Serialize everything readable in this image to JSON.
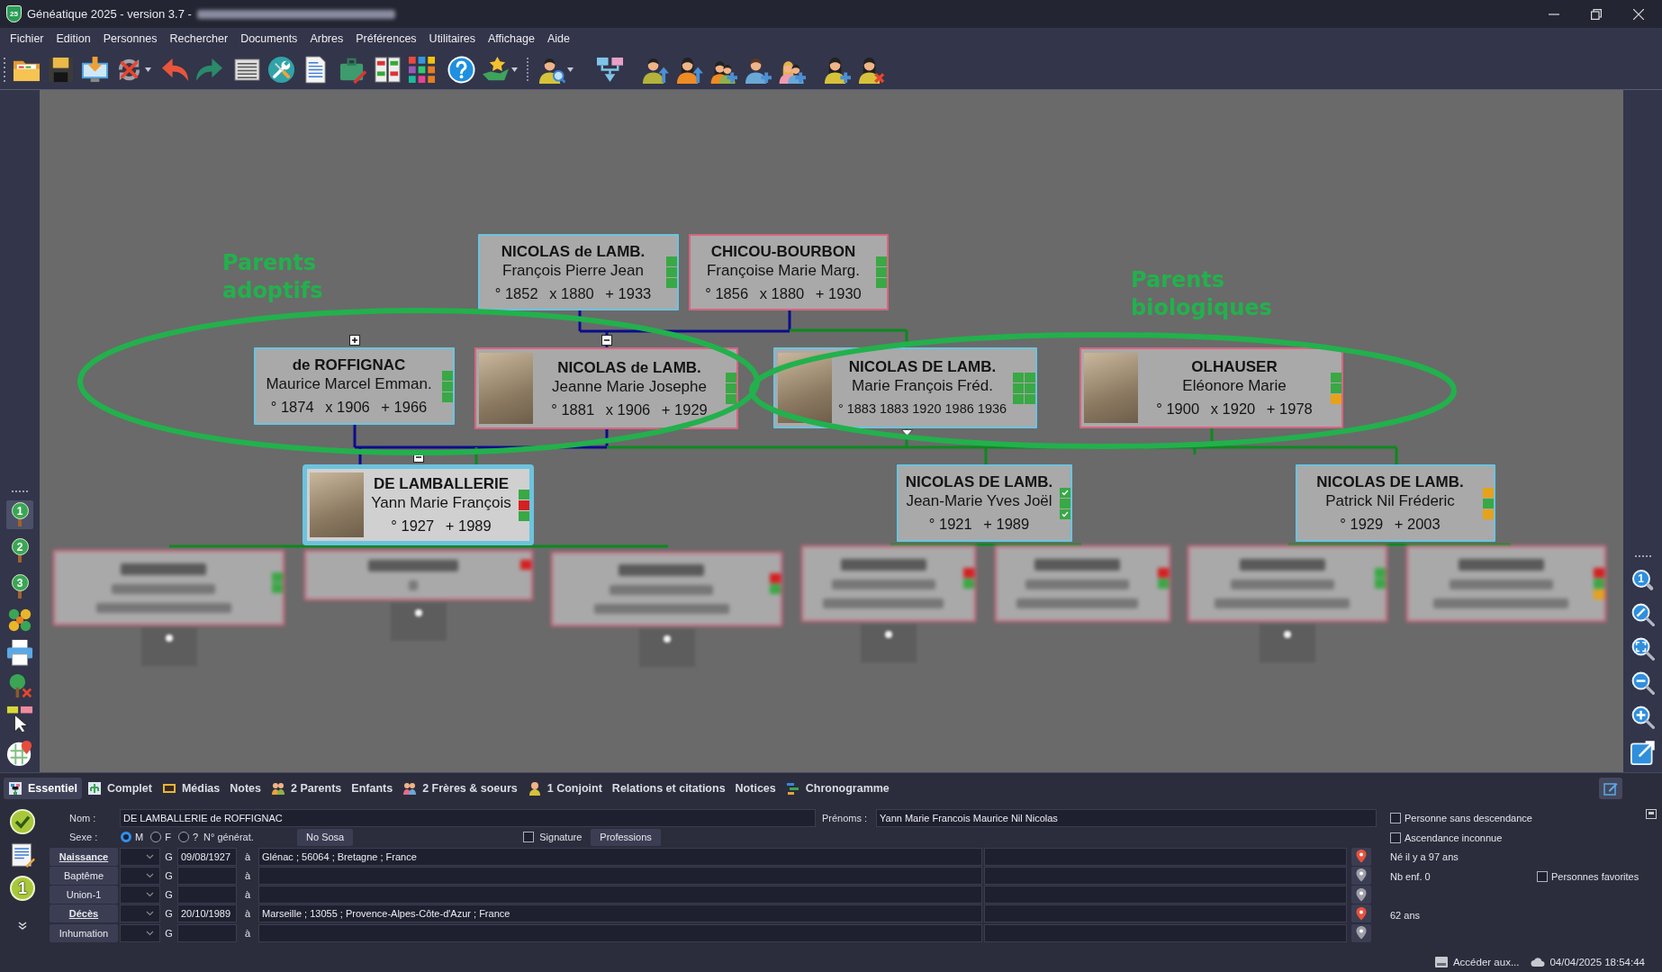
{
  "window": {
    "logo_text": "25",
    "title": "Généatique 2025 - version 3.7 -",
    "title_blurred": true
  },
  "menu": [
    "Fichier",
    "Edition",
    "Personnes",
    "Rechercher",
    "Documents",
    "Arbres",
    "Préférences",
    "Utilitaires",
    "Affichage",
    "Aide"
  ],
  "left_toolbar": {
    "generations": [
      {
        "label": "1",
        "selected": true
      },
      {
        "label": "2",
        "selected": false
      },
      {
        "label": "3",
        "selected": false
      }
    ]
  },
  "tree": {
    "annotations": [
      {
        "lines": [
          "Parents",
          "adoptifs"
        ]
      },
      {
        "lines": [
          "Parents",
          "biologiques"
        ]
      }
    ],
    "cards": [
      {
        "surname": "NICOLAS de LAMB.",
        "given_names": "François Pierre Jean",
        "dates": [
          "° 1852",
          "x 1880",
          "+ 1933"
        ],
        "kind": "male",
        "selected": false,
        "photo": false,
        "blurred": false,
        "markers": [
          {
            "color": "#39a845",
            "checked": false
          },
          {
            "color": "#39a845",
            "checked": false
          },
          {
            "color": "#39a845",
            "checked": false
          }
        ]
      },
      {
        "surname": "CHICOU-BOURBON",
        "given_names": "Françoise Marie Marg.",
        "dates": [
          "° 1856",
          "x 1880",
          "+ 1930"
        ],
        "kind": "female",
        "selected": false,
        "photo": false,
        "blurred": false,
        "markers": [
          {
            "color": "#39a845",
            "checked": false
          },
          {
            "color": "#39a845",
            "checked": false
          },
          {
            "color": "#39a845",
            "checked": false
          }
        ]
      },
      {
        "surname": "de ROFFIGNAC",
        "given_names": "Maurice Marcel Emman.",
        "dates": [
          "° 1874",
          "x 1906",
          "+ 1966"
        ],
        "kind": "male",
        "selected": false,
        "photo": false,
        "blurred": false,
        "branch_toggle": {
          "expanded": false
        },
        "markers": [
          {
            "color": "#39a845",
            "checked": false
          },
          {
            "color": "#39a845",
            "checked": false
          },
          {
            "color": "#39a845",
            "checked": false
          }
        ]
      },
      {
        "surname": "NICOLAS de LAMB.",
        "given_names": "Jeanne Marie Josephe",
        "dates": [
          "° 1881",
          "x 1906",
          "+ 1929"
        ],
        "kind": "female",
        "selected": false,
        "photo": true,
        "blurred": false,
        "branch_toggle": {
          "expanded": true
        },
        "markers": [
          {
            "color": "#39a845",
            "checked": false
          },
          {
            "color": "#39a845",
            "checked": false
          },
          {
            "color": "#39a845",
            "checked": false
          }
        ]
      },
      {
        "surname": "NICOLAS DE LAMB.",
        "given_names": "Marie François Fréd.",
        "dates": [
          "° 1883 1883 1920 1986 1936"
        ],
        "kind": "male",
        "selected": false,
        "photo": true,
        "blurred": false,
        "markers": [
          {
            "color": "#39a845",
            "checked": false
          },
          {
            "color": "#39a845",
            "checked": false
          },
          {
            "color": "#39a845",
            "checked": false
          },
          {
            "color": "#39a845",
            "checked": false
          },
          {
            "color": "#39a845",
            "checked": false
          },
          {
            "color": "#39a845",
            "checked": false
          }
        ]
      },
      {
        "surname": "OLHAUSER",
        "given_names": "Eléonore Marie",
        "dates": [
          "° 1900",
          "x 1920",
          "+ 1978"
        ],
        "kind": "female",
        "selected": false,
        "photo": true,
        "blurred": false,
        "markers": [
          {
            "color": "#39a845",
            "checked": false
          },
          {
            "color": "#39a845",
            "checked": false
          },
          {
            "color": "#e6a21a",
            "checked": false
          }
        ]
      },
      {
        "surname": "DE LAMBALLERIE",
        "given_names": "Yann Marie François",
        "dates": [
          "° 1927",
          "+ 1989"
        ],
        "kind": "male",
        "selected": true,
        "photo": true,
        "blurred": false,
        "branch_toggle": {
          "expanded": true
        },
        "markers": [
          {
            "color": "#39a845",
            "checked": false
          },
          {
            "color": "#d42020",
            "checked": false
          },
          {
            "color": "#39a845",
            "checked": false
          }
        ]
      },
      {
        "surname": "NICOLAS DE LAMB.",
        "given_names": "Jean-Marie Yves Joël",
        "dates": [
          "° 1921",
          "+ 1989"
        ],
        "kind": "male",
        "selected": false,
        "photo": false,
        "blurred": false,
        "markers": [
          {
            "color": "#39a845",
            "checked": true
          },
          {
            "color": "#39a845",
            "checked": false
          },
          {
            "color": "#39a845",
            "checked": true
          }
        ]
      },
      {
        "surname": "NICOLAS DE LAMB.",
        "given_names": "Patrick Nil Fréderic",
        "dates": [
          "° 1929",
          "+ 2003"
        ],
        "kind": "male",
        "selected": false,
        "photo": false,
        "blurred": false,
        "markers": [
          {
            "color": "#e6a21a",
            "checked": false
          },
          {
            "color": "#39a845",
            "checked": false
          },
          {
            "color": "#e6a21a",
            "checked": false
          }
        ]
      },
      {
        "kind": "female",
        "selected": false,
        "photo": false,
        "blurred": true,
        "has_children": true,
        "markers": [
          {
            "color": "#39a845",
            "checked": false
          },
          {
            "color": "#39a845",
            "checked": false
          }
        ]
      },
      {
        "kind": "female",
        "selected": false,
        "photo": false,
        "blurred": true,
        "has_children": true,
        "markers": [
          {
            "color": "#d42020",
            "checked": false
          }
        ]
      },
      {
        "kind": "female",
        "selected": false,
        "photo": false,
        "blurred": true,
        "has_children": true,
        "markers": [
          {
            "color": "#d42020",
            "checked": false
          },
          {
            "color": "#39a845",
            "checked": false
          }
        ]
      },
      {
        "kind": "female",
        "selected": false,
        "photo": false,
        "blurred": true,
        "has_children": true,
        "markers": [
          {
            "color": "#d42020",
            "checked": false
          },
          {
            "color": "#39a845",
            "checked": false
          }
        ]
      },
      {
        "kind": "female",
        "selected": false,
        "photo": false,
        "blurred": true,
        "has_children": false,
        "markers": [
          {
            "color": "#d42020",
            "checked": false
          },
          {
            "color": "#39a845",
            "checked": false
          }
        ]
      },
      {
        "kind": "female",
        "selected": false,
        "photo": false,
        "blurred": true,
        "has_children": true,
        "markers": [
          {
            "color": "#39a845",
            "checked": false
          },
          {
            "color": "#39a845",
            "checked": false
          }
        ]
      },
      {
        "kind": "female",
        "selected": false,
        "photo": false,
        "blurred": true,
        "has_children": false,
        "markers": [
          {
            "color": "#d42020",
            "checked": false
          },
          {
            "color": "#39a845",
            "checked": false
          },
          {
            "color": "#e6a21a",
            "checked": false
          }
        ]
      }
    ]
  },
  "right_toolbar": {
    "zoom_label": "1"
  },
  "tabs": [
    {
      "label": "Essentiel",
      "selected": true
    },
    {
      "label": "Complet",
      "selected": false
    },
    {
      "label": "Médias",
      "selected": false
    },
    {
      "label": "Notes",
      "selected": false
    },
    {
      "label": "2 Parents",
      "selected": false
    },
    {
      "label": "Enfants",
      "selected": false
    },
    {
      "label": "2 Frères & soeurs",
      "selected": false
    },
    {
      "label": "1 Conjoint",
      "selected": false
    },
    {
      "label": "Relations et citations",
      "selected": false
    },
    {
      "label": "Notices",
      "selected": false
    },
    {
      "label": "Chronogramme",
      "selected": false
    }
  ],
  "form": {
    "generation_badge": "1",
    "name": {
      "label": "Nom :",
      "value": "DE LAMBALLERIE de ROFFIGNAC"
    },
    "first_names": {
      "label": "Prénoms :",
      "value": "Yann Marie Francois Maurice Nil Nicolas"
    },
    "sex": {
      "label": "Sexe :",
      "options": [
        {
          "label": "M",
          "selected": true
        },
        {
          "label": "F",
          "selected": false
        },
        {
          "label": "?",
          "selected": false
        }
      ]
    },
    "generation_label": "N° générat.",
    "sosa_button": "No Sosa",
    "signature": {
      "label": "Signature",
      "checked": false
    },
    "professions_button": "Professions",
    "events": [
      {
        "label": "Naissance",
        "recorded": true,
        "source": "G",
        "date": "09/08/1927",
        "at": "à",
        "place": "Glénac ; 56064 ; Bretagne ; France"
      },
      {
        "label": "Baptême",
        "recorded": false,
        "source": "G",
        "at": "à"
      },
      {
        "label": "Union-1",
        "recorded": false,
        "source": "G",
        "at": "à"
      },
      {
        "label": "Décès",
        "recorded": true,
        "source": "G",
        "date": "20/10/1989",
        "at": "à",
        "place": "Marseille ; 13055 ; Provence-Alpes-Côte-d'Azur ; France"
      },
      {
        "label": "Inhumation",
        "recorded": false,
        "source": "G",
        "at": "à"
      }
    ],
    "options": [
      {
        "label": "Personne sans descendance",
        "checked": false
      },
      {
        "label": "Ascendance inconnue",
        "checked": false
      }
    ],
    "born_ago": "Né il y a 97 ans",
    "children_count": "Nb enf. 0",
    "favorites": {
      "label": "Personnes favorites",
      "checked": false
    },
    "age_at_death": "62 ans"
  },
  "status_bar": {
    "link": "Accéder aux...",
    "datetime": "04/04/2025 18:54:44"
  }
}
